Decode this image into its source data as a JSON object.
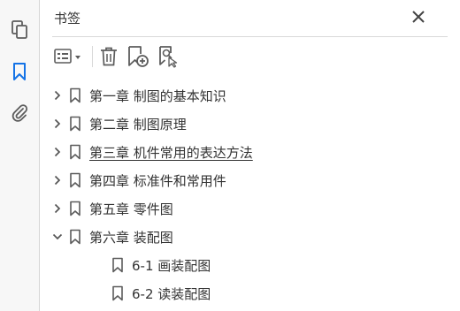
{
  "rail": {
    "items": [
      {
        "name": "pages-thumbnails-icon",
        "active": false
      },
      {
        "name": "bookmarks-icon",
        "active": true
      },
      {
        "name": "attachments-icon",
        "active": false
      }
    ]
  },
  "panel": {
    "title": "书签",
    "toolbar": {
      "options_icon": "options-menu-icon",
      "delete_icon": "trash-icon",
      "new_bookmark_icon": "new-bookmark-icon",
      "find_bookmark_icon": "find-current-bookmark-icon"
    }
  },
  "bookmarks": [
    {
      "label": "第一章  制图的基本知识",
      "level": 0,
      "expanded": false,
      "underlined": false
    },
    {
      "label": "第二章  制图原理",
      "level": 0,
      "expanded": false,
      "underlined": false
    },
    {
      "label": "第三章  机件常用的表达方法",
      "level": 0,
      "expanded": false,
      "underlined": true
    },
    {
      "label": "第四章  标准件和常用件",
      "level": 0,
      "expanded": false,
      "underlined": false
    },
    {
      "label": "第五章  零件图",
      "level": 0,
      "expanded": false,
      "underlined": false
    },
    {
      "label": "第六章  装配图",
      "level": 0,
      "expanded": true,
      "underlined": false
    },
    {
      "label": "6-1  画装配图",
      "level": 1,
      "expanded": null,
      "underlined": false
    },
    {
      "label": "6-2  读装配图",
      "level": 1,
      "expanded": null,
      "underlined": false
    }
  ],
  "colors": {
    "accent": "#1473e6",
    "icon": "#5c5c5c",
    "rail_bg": "#f7f7f7"
  }
}
